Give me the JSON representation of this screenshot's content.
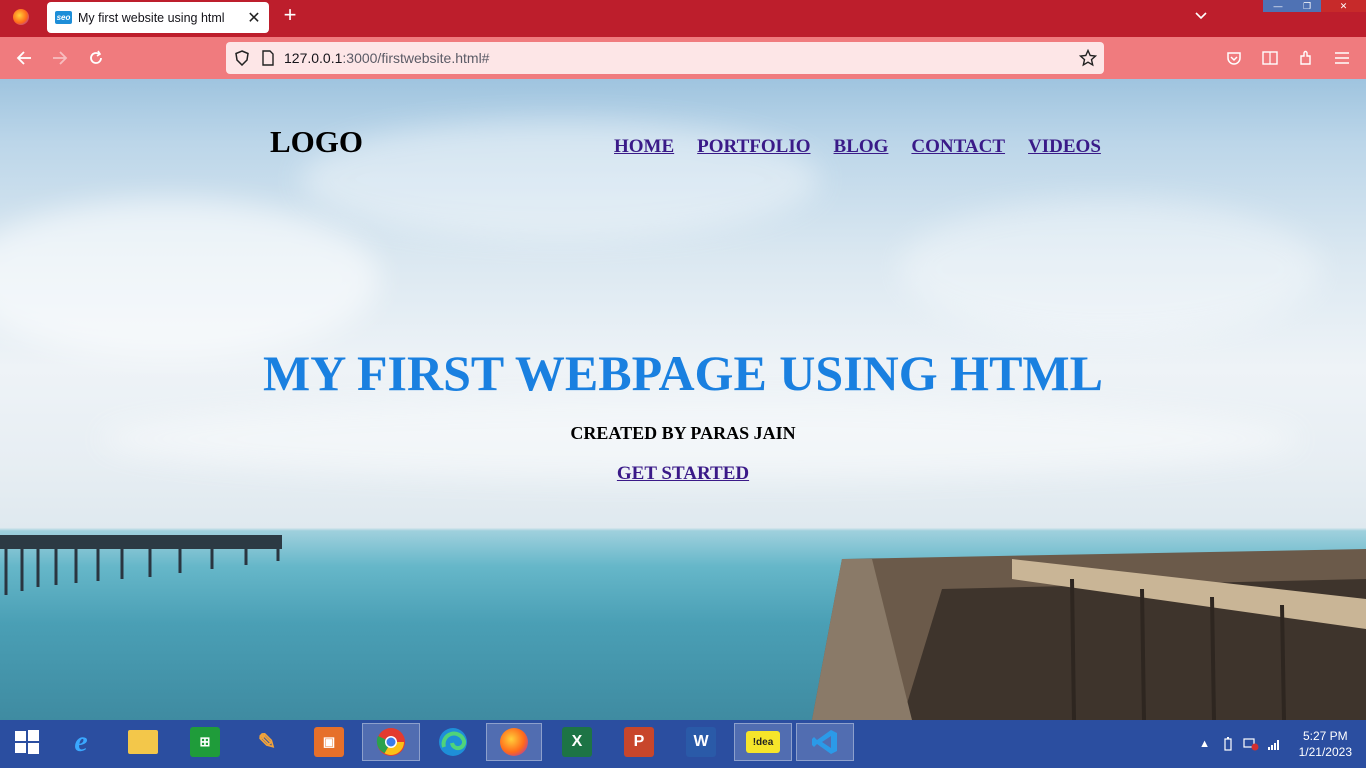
{
  "browser": {
    "tab": {
      "title": "My first website using html",
      "favicon_text": "seo"
    },
    "url": {
      "host": "127.0.0.1",
      "rest": ":3000/firstwebsite.html#"
    }
  },
  "page": {
    "logo": "LOGO",
    "menu": [
      "HOME",
      "PORTFOLIO",
      "BLOG",
      "CONTACT",
      "VIDEOS"
    ],
    "hero_title": "MY FIRST WEBPAGE USING HTML",
    "hero_subtitle": "CREATED BY PARAS JAIN",
    "cta": "GET STARTED",
    "colors": {
      "title": "#1a80e0",
      "link": "#3a1a88"
    }
  },
  "taskbar": {
    "items": [
      {
        "name": "start",
        "icon": "windows-icon"
      },
      {
        "name": "ie",
        "icon": "internet-explorer-icon"
      },
      {
        "name": "explorer",
        "icon": "file-explorer-icon"
      },
      {
        "name": "store",
        "icon": "store-icon"
      },
      {
        "name": "app4",
        "icon": "app-icon"
      },
      {
        "name": "app5",
        "icon": "app-icon"
      },
      {
        "name": "chrome",
        "icon": "chrome-icon"
      },
      {
        "name": "edge",
        "icon": "edge-icon"
      },
      {
        "name": "firefox",
        "icon": "firefox-icon"
      },
      {
        "name": "excel",
        "icon": "excel-icon",
        "label": "X"
      },
      {
        "name": "powerpoint",
        "icon": "powerpoint-icon",
        "label": "P"
      },
      {
        "name": "word",
        "icon": "word-icon",
        "label": "W"
      },
      {
        "name": "idea",
        "icon": "idea-icon",
        "label": "!dea"
      },
      {
        "name": "vscode",
        "icon": "vscode-icon"
      }
    ],
    "clock": {
      "time": "5:27 PM",
      "date": "1/21/2023"
    }
  }
}
